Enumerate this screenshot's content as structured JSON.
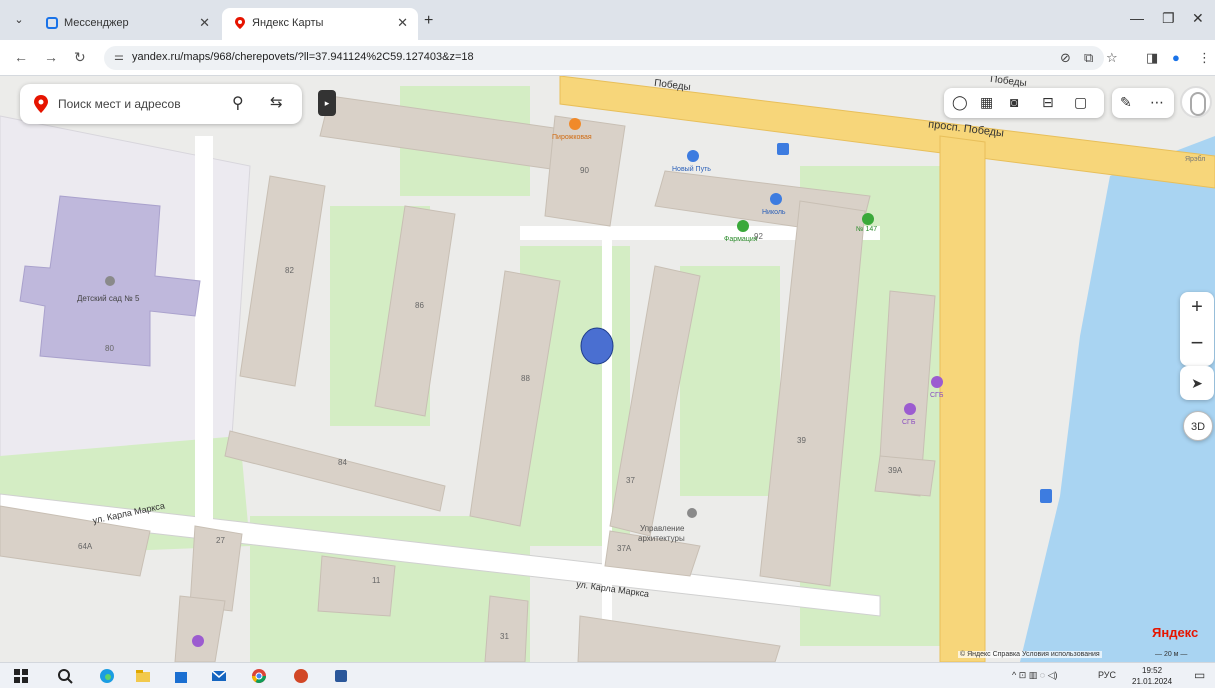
{
  "browser": {
    "tabs": [
      {
        "title": "Мессенджер"
      },
      {
        "title": "Яндекс Карты"
      }
    ],
    "url": "yandex.ru/maps/968/cherepovets/?ll=37.941124%2C59.127403&z=18"
  },
  "search": {
    "placeholder": "Поиск мест и адресов"
  },
  "map": {
    "labels": {
      "prospekt_pobedy": "просп. Победы",
      "pobedy_top": "Победы",
      "pobedy_right": "Победы",
      "marksa_left": "ул. Карла Маркса",
      "marksa_bottom": "ул. Карла Маркса",
      "sadik": "Детский сад № 5",
      "pirozhkovaya": "Пирожковая",
      "novy_put": "Новый Путь",
      "nikol": "Николь",
      "farmaciya": "Фармация",
      "n147": "№ 147",
      "sgb1": "СГБ",
      "sgb2": "СГБ",
      "upravlenie1": "Управление",
      "upravlenie2": "архитектуры",
      "yarobl": "Ярэбл"
    },
    "house_numbers": {
      "h90": "90",
      "h92": "92",
      "h82": "82",
      "h86": "86",
      "h88": "88",
      "h84": "84",
      "h80": "80",
      "h37": "37",
      "h37a": "37А",
      "h39": "39",
      "h39a": "39А",
      "h64a": "64А",
      "h27": "27",
      "h11": "11",
      "h31": "31"
    }
  },
  "controls": {
    "zoom_in": "+",
    "zoom_out": "−",
    "btn_3d": "3D"
  },
  "footer": {
    "logo": "Яндекс",
    "attribution": "© Яндекс  Справка  Условия использования",
    "scale": "— 20 м —"
  },
  "taskbar": {
    "language": "РУС",
    "time": "19:52",
    "date": "21.01.2024"
  },
  "colors": {
    "accent_red": "#e61400",
    "road_yellow": "#f7d67a",
    "water": "#a9d4f2",
    "park": "#d4edc4",
    "building": "#d9d1c8",
    "marker": "#4a6fd1"
  }
}
